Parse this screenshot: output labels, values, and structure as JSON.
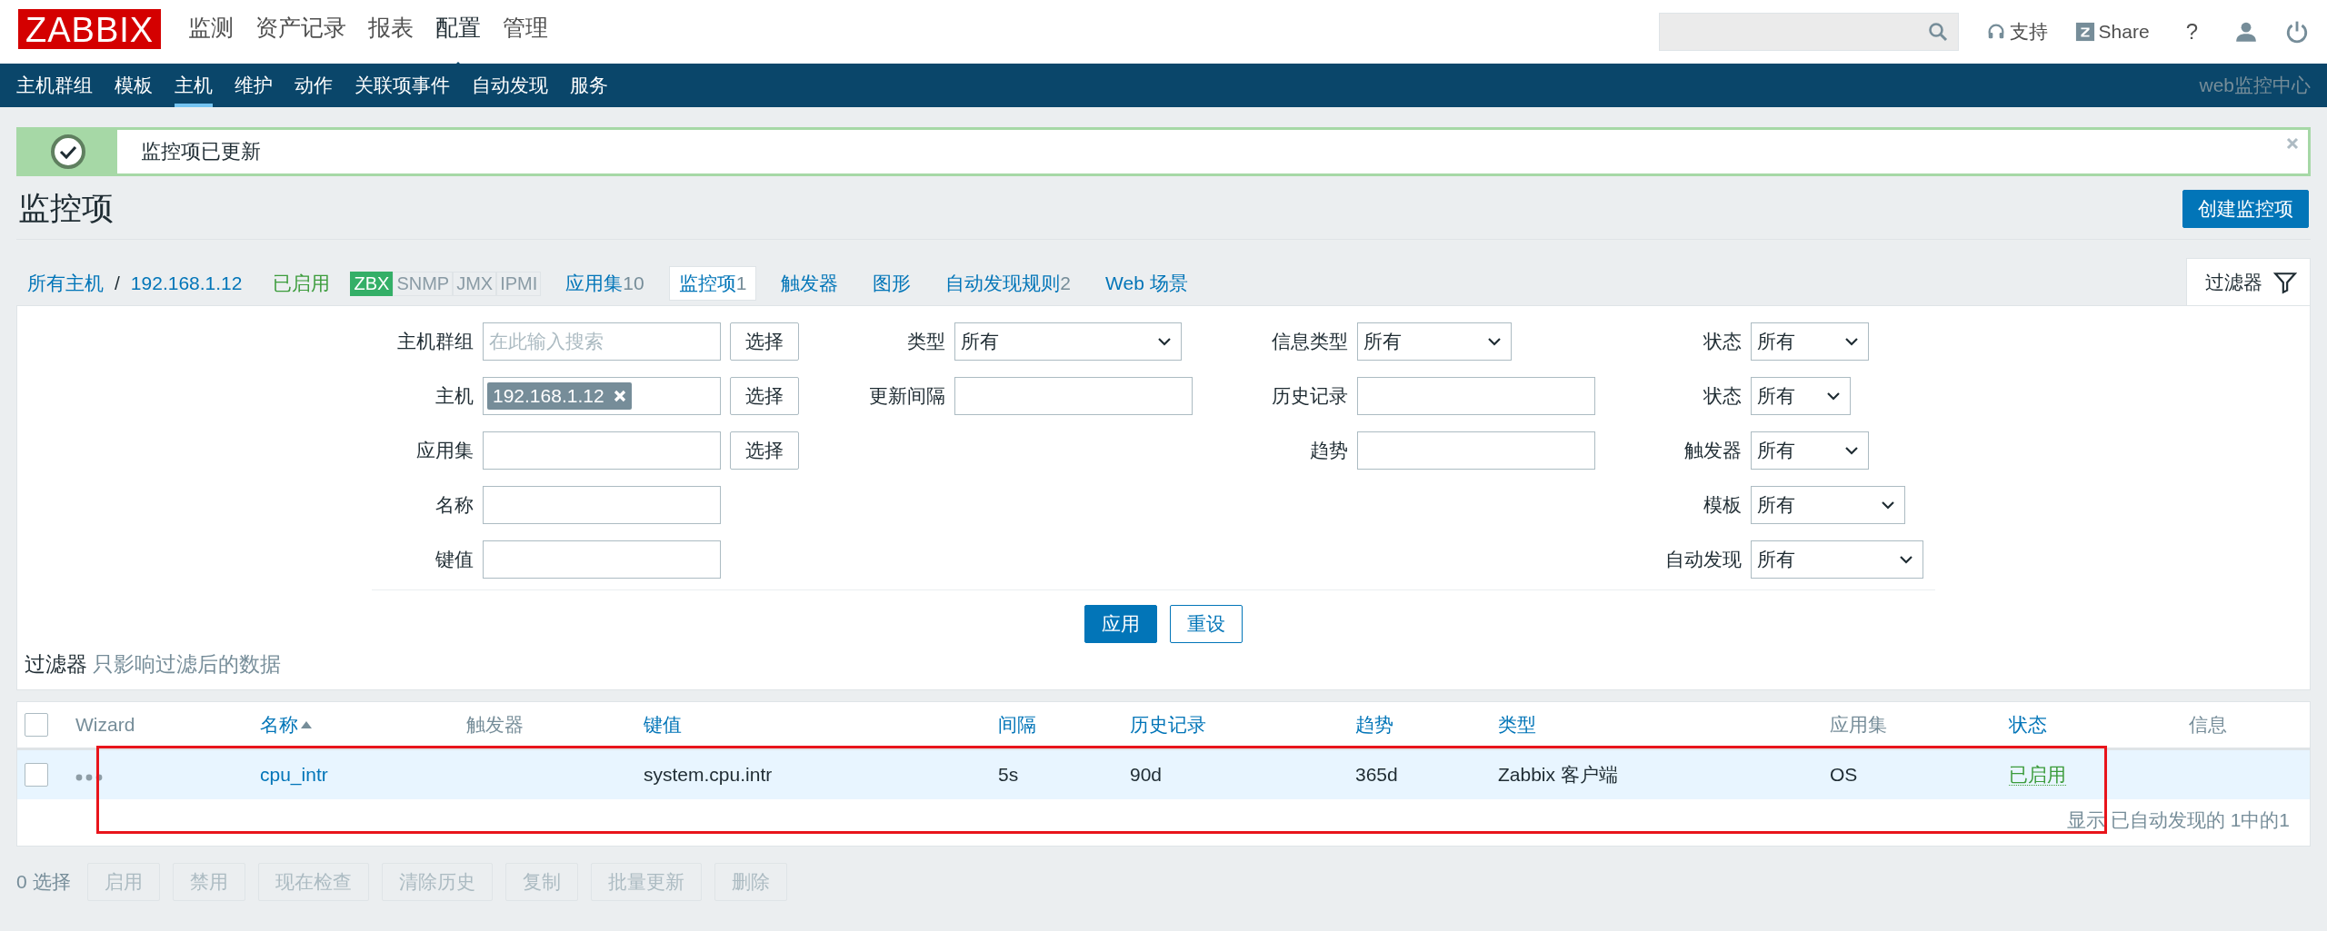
{
  "logo": "ZABBIX",
  "main_menu": [
    {
      "label": "监测",
      "selected": false
    },
    {
      "label": "资产记录",
      "selected": false
    },
    {
      "label": "报表",
      "selected": false
    },
    {
      "label": "配置",
      "selected": true
    },
    {
      "label": "管理",
      "selected": false
    }
  ],
  "header_tools": {
    "support": "支持",
    "share": "Share",
    "help": "?"
  },
  "sub_menu": [
    {
      "label": "主机群组",
      "selected": false
    },
    {
      "label": "模板",
      "selected": false
    },
    {
      "label": "主机",
      "selected": true
    },
    {
      "label": "维护",
      "selected": false
    },
    {
      "label": "动作",
      "selected": false
    },
    {
      "label": "关联项事件",
      "selected": false
    },
    {
      "label": "自动发现",
      "selected": false
    },
    {
      "label": "服务",
      "selected": false
    }
  ],
  "server_name": "web监控中心",
  "message": {
    "kind": "success",
    "text": "监控项已更新"
  },
  "page_title": "监控项",
  "create_button": "创建监控项",
  "breadcrumbs": [
    "所有主机",
    "192.168.1.12"
  ],
  "breadcrumb_separator": "/",
  "host_status": "已启用",
  "availability": [
    {
      "label": "ZBX",
      "on": true
    },
    {
      "label": "SNMP",
      "on": false
    },
    {
      "label": "JMX",
      "on": false
    },
    {
      "label": "IPMI",
      "on": false
    }
  ],
  "host_tabs": [
    {
      "label": "应用集",
      "count": "10",
      "selected": false
    },
    {
      "label": "监控项",
      "count": "1",
      "selected": true
    },
    {
      "label": "触发器",
      "selected": false
    },
    {
      "label": "图形",
      "selected": false
    },
    {
      "label": "自动发现规则",
      "count": "2",
      "selected": false
    },
    {
      "label": "Web 场景",
      "selected": false
    }
  ],
  "filter_tab": {
    "label": "过滤器",
    "expanded": true
  },
  "filter": {
    "columns": [
      {
        "fields": [
          {
            "label": "主机群组",
            "kind": "multiselect",
            "placeholder": "在此输入搜索",
            "button": "选择"
          },
          {
            "label": "主机",
            "kind": "multiselect",
            "tag": "192.168.1.12",
            "button": "选择"
          },
          {
            "label": "应用集",
            "kind": "multiselect",
            "button": "选择"
          },
          {
            "label": "名称",
            "kind": "text"
          },
          {
            "label": "键值",
            "kind": "text"
          }
        ]
      },
      {
        "fields": [
          {
            "label": "类型",
            "kind": "select",
            "value": "所有"
          },
          {
            "label": "更新间隔",
            "kind": "text"
          }
        ]
      },
      {
        "fields": [
          {
            "label": "信息类型",
            "kind": "select",
            "value": "所有"
          },
          {
            "label": "历史记录",
            "kind": "text"
          },
          {
            "label": "趋势",
            "kind": "text"
          }
        ]
      },
      {
        "fields": [
          {
            "label": "状态",
            "kind": "select",
            "value": "所有"
          },
          {
            "label": "状态",
            "kind": "select",
            "value": "所有"
          },
          {
            "label": "触发器",
            "kind": "select",
            "value": "所有"
          },
          {
            "label": "模板",
            "kind": "select",
            "value": "所有"
          },
          {
            "label": "自动发现",
            "kind": "select",
            "value": "所有"
          }
        ]
      }
    ],
    "apply": "应用",
    "reset": "重设"
  },
  "filter_note": {
    "title": "过滤器",
    "text": "只影响过滤后的数据"
  },
  "table": {
    "select_all": {
      "checked": false
    },
    "columns": [
      {
        "label": "Wizard",
        "sortable": false
      },
      {
        "label": "名称",
        "sortable": true,
        "sorted_ascending": true
      },
      {
        "label": "触发器",
        "sortable": false
      },
      {
        "label": "键值",
        "sortable": true
      },
      {
        "label": "间隔",
        "sortable": true
      },
      {
        "label": "历史记录",
        "sortable": true
      },
      {
        "label": "趋势",
        "sortable": true
      },
      {
        "label": "类型",
        "sortable": true
      },
      {
        "label": "应用集",
        "sortable": false
      },
      {
        "label": "状态",
        "sortable": true
      },
      {
        "label": "信息",
        "sortable": false
      }
    ],
    "rows": [
      {
        "checked": false,
        "highlighted": true,
        "name": "cpu_intr",
        "key": "system.cpu.intr",
        "interval": "5s",
        "history": "90d",
        "trends": "365d",
        "type": "Zabbix 客户端",
        "applications": "OS",
        "status": "已启用",
        "enabled": true
      }
    ],
    "footer": "显示 已自动发现的 1中的1"
  },
  "selection_count": "0 选择",
  "actions": [
    {
      "label": "启用",
      "disabled": true
    },
    {
      "label": "禁用",
      "disabled": true
    },
    {
      "label": "现在检查",
      "disabled": true
    },
    {
      "label": "清除历史",
      "disabled": true
    },
    {
      "label": "复制",
      "disabled": true
    },
    {
      "label": "批量更新",
      "disabled": true
    },
    {
      "label": "删除",
      "disabled": true
    }
  ]
}
